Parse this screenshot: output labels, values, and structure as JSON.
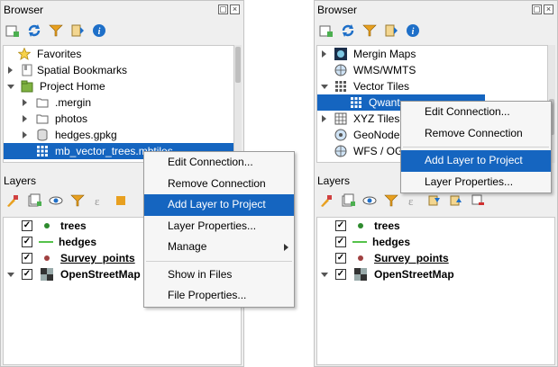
{
  "left": {
    "browser_title": "Browser",
    "tree": [
      {
        "label": "Favorites",
        "icon": "star-icon"
      },
      {
        "label": "Spatial Bookmarks",
        "icon": "bookmark-icon"
      },
      {
        "label": "Project Home",
        "icon": "project-home-icon"
      },
      {
        "label": ".mergin",
        "icon": "folder-icon"
      },
      {
        "label": "photos",
        "icon": "folder-icon"
      },
      {
        "label": "hedges.gpkg",
        "icon": "geopackage-icon"
      },
      {
        "label": "mb_vector_trees.mbtiles",
        "icon": "vector-tiles-icon"
      }
    ],
    "layers_title": "Layers",
    "layers": [
      {
        "label": "trees",
        "symbol": "point",
        "color": "#2e8b2e"
      },
      {
        "label": "hedges",
        "symbol": "line",
        "color": "#55c24a"
      },
      {
        "label": "Survey_points",
        "symbol": "point",
        "color": "#a04040"
      },
      {
        "label": "OpenStreetMap",
        "symbol": "raster"
      }
    ],
    "menu": [
      {
        "label": "Edit Connection..."
      },
      {
        "label": "Remove Connection"
      },
      {
        "label": "Add Layer to Project"
      },
      {
        "label": "Layer Properties..."
      },
      {
        "label": "Manage"
      },
      {
        "label": "Show in Files"
      },
      {
        "label": "File Properties..."
      }
    ]
  },
  "right": {
    "browser_title": "Browser",
    "tree": [
      {
        "label": "Mergin Maps",
        "icon": "mergin-maps-icon"
      },
      {
        "label": "WMS/WMTS",
        "icon": "globe-icon"
      },
      {
        "label": "Vector Tiles",
        "icon": "vector-tiles-icon"
      },
      {
        "label": "Qwant",
        "icon": "vector-tiles-icon"
      },
      {
        "label": "XYZ Tiles",
        "icon": "xyz-tiles-icon"
      },
      {
        "label": "GeoNode",
        "icon": "geonode-icon"
      },
      {
        "label": "WFS / OGC API - Features",
        "icon": "globe-icon"
      }
    ],
    "layers_title": "Layers",
    "layers": [
      {
        "label": "trees",
        "symbol": "point",
        "color": "#2e8b2e"
      },
      {
        "label": "hedges",
        "symbol": "line",
        "color": "#55c24a"
      },
      {
        "label": "Survey_points",
        "symbol": "point",
        "color": "#a04040"
      },
      {
        "label": "OpenStreetMap",
        "symbol": "raster"
      }
    ],
    "menu": [
      {
        "label": "Edit Connection..."
      },
      {
        "label": "Remove Connection"
      },
      {
        "label": "Add Layer to Project"
      },
      {
        "label": "Layer Properties..."
      }
    ]
  },
  "accent": "#1565c0"
}
